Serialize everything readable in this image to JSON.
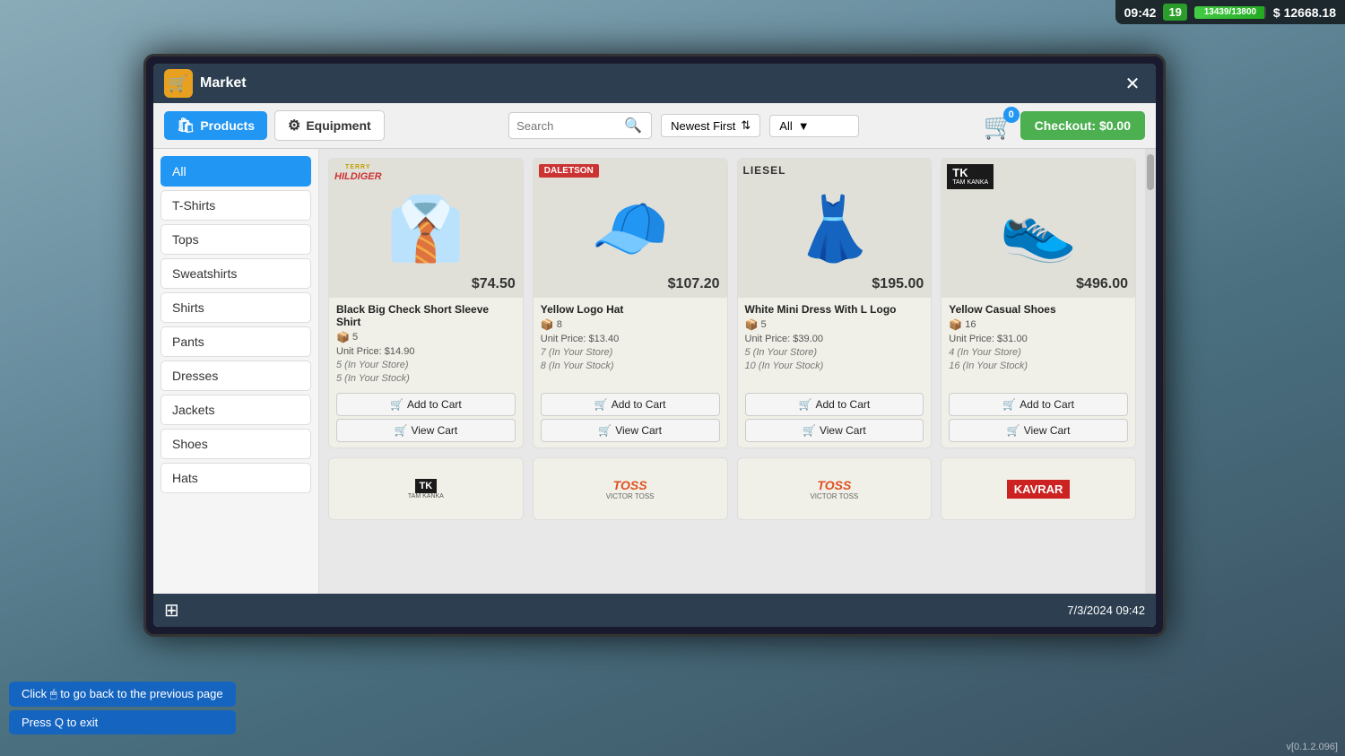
{
  "hud": {
    "time": "09:42",
    "level": "19",
    "xp": "13439/13800",
    "money": "$ 12668.18"
  },
  "window": {
    "title": "Market",
    "close_label": "✕"
  },
  "tabs": [
    {
      "id": "products",
      "label": "Products",
      "active": true
    },
    {
      "id": "equipment",
      "label": "Equipment",
      "active": false
    }
  ],
  "search": {
    "placeholder": "Search",
    "sort_label": "Newest First",
    "filter_label": "All"
  },
  "checkout": {
    "badge": "0",
    "label": "Checkout: $0.00"
  },
  "sidebar": {
    "items": [
      {
        "id": "all",
        "label": "All",
        "active": true
      },
      {
        "id": "tshirts",
        "label": "T-Shirts",
        "active": false
      },
      {
        "id": "tops",
        "label": "Tops",
        "active": false
      },
      {
        "id": "sweatshirts",
        "label": "Sweatshirts",
        "active": false
      },
      {
        "id": "shirts",
        "label": "Shirts",
        "active": false
      },
      {
        "id": "pants",
        "label": "Pants",
        "active": false
      },
      {
        "id": "dresses",
        "label": "Dresses",
        "active": false
      },
      {
        "id": "jackets",
        "label": "Jackets",
        "active": false
      },
      {
        "id": "shoes",
        "label": "Shoes",
        "active": false
      },
      {
        "id": "hats",
        "label": "Hats",
        "active": false
      }
    ]
  },
  "products": [
    {
      "id": "p1",
      "brand": "TERRY HILDIGER",
      "brand_type": "tommy",
      "name": "Black Big Check Short Sleeve Shirt",
      "price": "$74.50",
      "qty_box": "5",
      "unit_price": "$14.90",
      "in_store": "5 (In Your Store)",
      "in_stock": "5 (In Your Stock)",
      "emoji": "👔",
      "add_label": "Add to Cart",
      "view_label": "View Cart"
    },
    {
      "id": "p2",
      "brand": "DALETSON",
      "brand_type": "daletson",
      "name": "Yellow Logo Hat",
      "price": "$107.20",
      "qty_box": "8",
      "unit_price": "$13.40",
      "in_store": "7 (In Your Store)",
      "in_stock": "8 (In Your Stock)",
      "emoji": "🧢",
      "add_label": "Add to Cart",
      "view_label": "View Cart"
    },
    {
      "id": "p3",
      "brand": "LIESEL",
      "brand_type": "liesel",
      "name": "White Mini Dress With L Logo",
      "price": "$195.00",
      "qty_box": "5",
      "unit_price": "$39.00",
      "in_store": "5 (In Your Store)",
      "in_stock": "10 (In Your Stock)",
      "emoji": "👗",
      "add_label": "Add to Cart",
      "view_label": "View Cart"
    },
    {
      "id": "p4",
      "brand": "TK",
      "brand_sub": "TAM KANKA",
      "brand_type": "tk",
      "name": "Yellow Casual Shoes",
      "price": "$496.00",
      "qty_box": "16",
      "unit_price": "$31.00",
      "in_store": "4 (In Your Store)",
      "in_stock": "16 (In Your Stock)",
      "emoji": "👟",
      "add_label": "Add to Cart",
      "view_label": "View Cart"
    }
  ],
  "partial_products": [
    {
      "id": "pp1",
      "brand": "TK",
      "brand_sub": "TAM KANKA",
      "brand_type": "tk"
    },
    {
      "id": "pp2",
      "brand": "TOSS",
      "brand_sub": "VICTOR TOSS",
      "brand_type": "toss"
    },
    {
      "id": "pp3",
      "brand": "TOSS",
      "brand_sub": "VICTOR TOSS",
      "brand_type": "toss"
    },
    {
      "id": "pp4",
      "brand": "KAVRAR",
      "brand_type": "kavrar"
    }
  ],
  "bottom": {
    "datetime": "7/3/2024  09:42"
  },
  "hints": [
    "Click 🖱 to go back to the previous page",
    "Press Q to exit"
  ],
  "version": "v[0.1.2.096]"
}
